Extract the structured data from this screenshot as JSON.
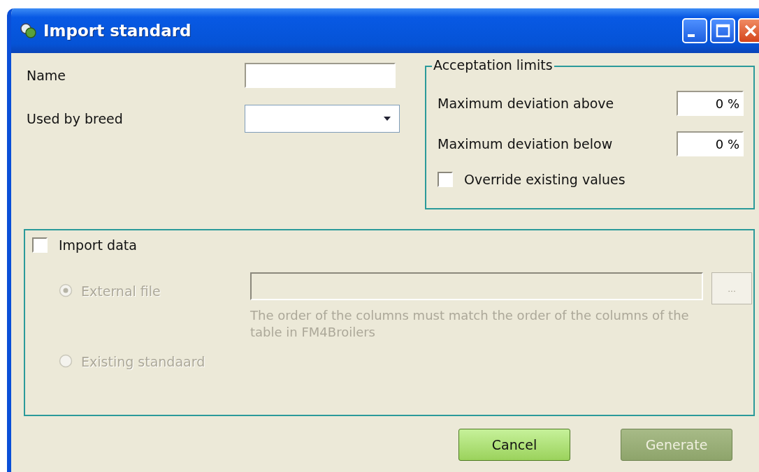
{
  "window": {
    "title": "Import standard"
  },
  "fields": [
    {
      "kind": "text",
      "label": "Name"
    },
    {
      "kind": "dropdown",
      "label": "Used by breed"
    }
  ],
  "acceptation_limits": {
    "title": "Acceptation limits",
    "rows": [
      {
        "label": "Maximum deviation above",
        "value": "0 %"
      },
      {
        "label": "Maximum deviation below",
        "value": "0 %"
      }
    ],
    "override": {
      "label": "Override existing values",
      "checked": false
    }
  },
  "import_data": {
    "label": "Import data",
    "checked": false,
    "options": [
      {
        "kind": "file",
        "label": "External file",
        "selected": true,
        "disabled": true,
        "browse": "...",
        "hint": "The order of the columns must match the order of the columns of the table in  FM4Broilers"
      },
      {
        "kind": "plain",
        "label": "Existing standaard",
        "selected": false,
        "disabled": true
      }
    ]
  },
  "buttons": [
    {
      "label": "Cancel",
      "disabled": false
    },
    {
      "label": "Generate",
      "disabled": true
    }
  ]
}
